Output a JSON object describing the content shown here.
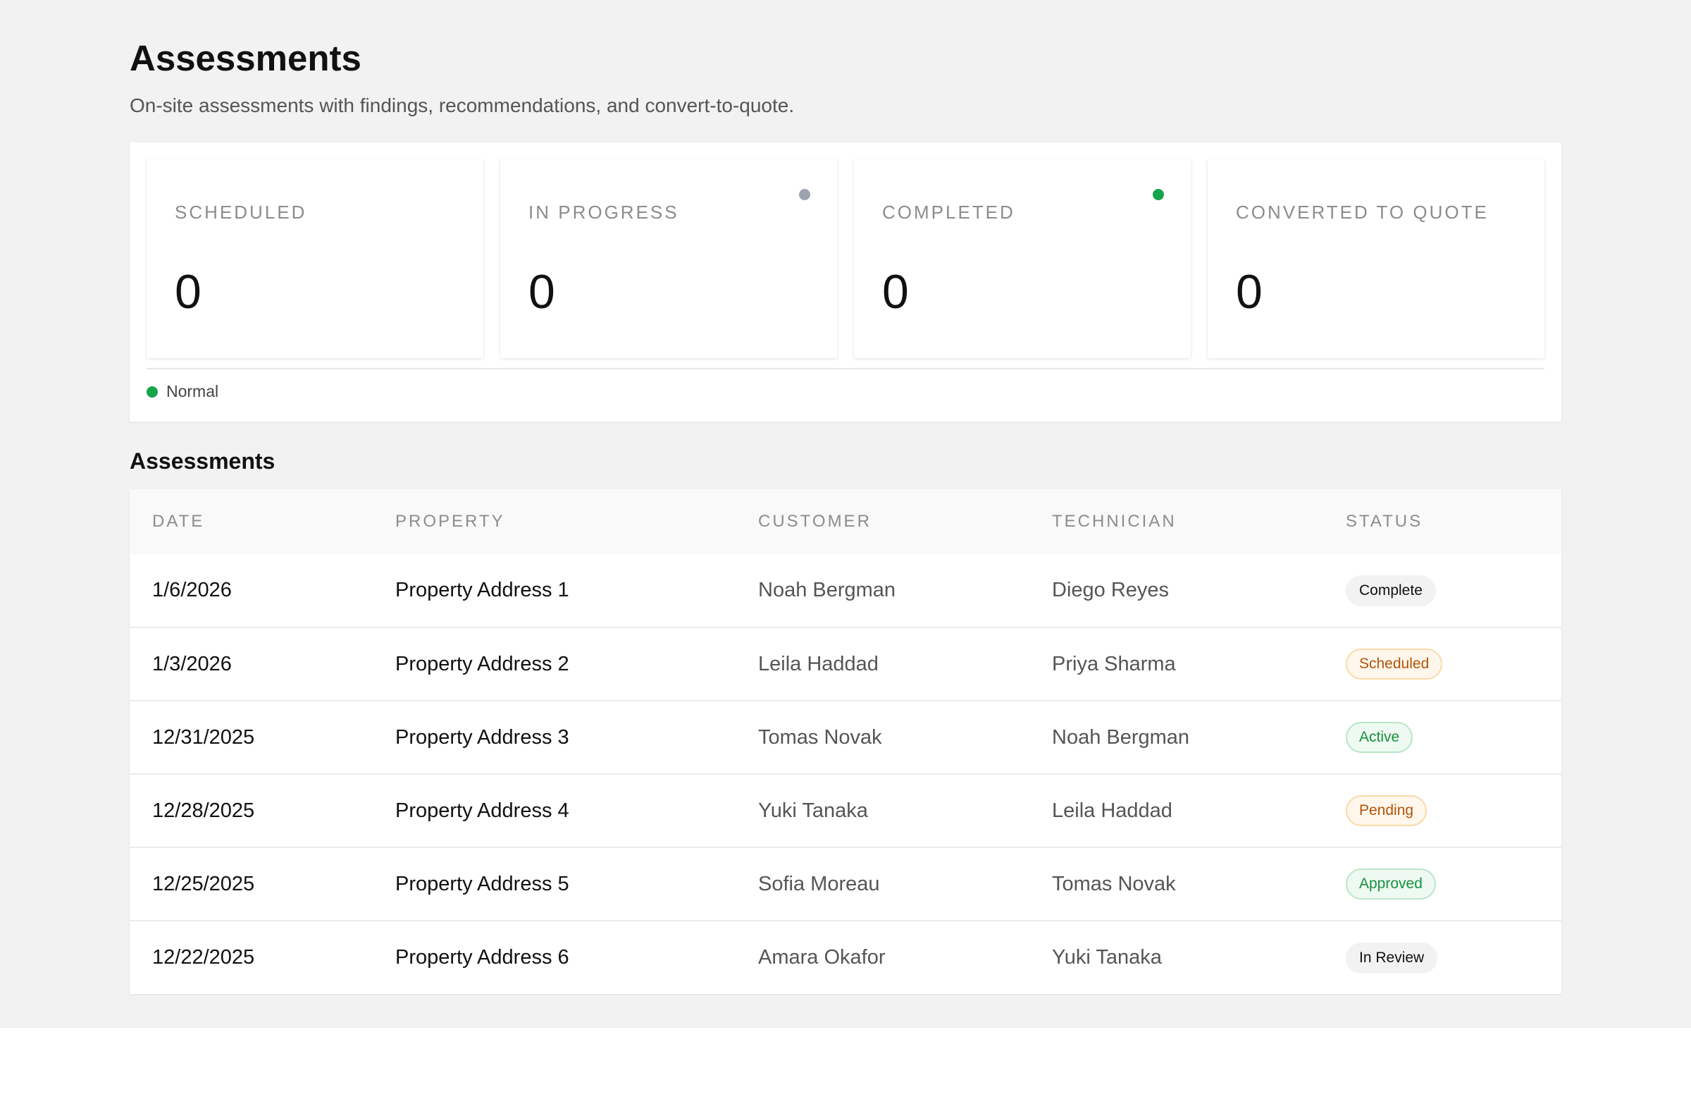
{
  "header": {
    "title": "Assessments",
    "subtitle": "On-site assessments with findings, recommendations, and convert-to-quote."
  },
  "kpis": [
    {
      "label": "SCHEDULED",
      "value": "0",
      "dot_color": null
    },
    {
      "label": "IN PROGRESS",
      "value": "0",
      "dot_color": "#9ca3af"
    },
    {
      "label": "COMPLETED",
      "value": "0",
      "dot_color": "#16a34a"
    },
    {
      "label": "CONVERTED TO QUOTE",
      "value": "0",
      "dot_color": null
    }
  ],
  "legend": {
    "label": "Normal",
    "color": "#16a34a"
  },
  "table": {
    "section_title": "Assessments",
    "columns": [
      "DATE",
      "PROPERTY",
      "CUSTOMER",
      "TECHNICIAN",
      "STATUS"
    ],
    "rows": [
      {
        "date": "1/6/2026",
        "property": "Property Address 1",
        "customer": "Noah Bergman",
        "technician": "Diego Reyes",
        "status": "Complete",
        "status_tone": "neutral"
      },
      {
        "date": "1/3/2026",
        "property": "Property Address 2",
        "customer": "Leila Haddad",
        "technician": "Priya Sharma",
        "status": "Scheduled",
        "status_tone": "warning"
      },
      {
        "date": "12/31/2025",
        "property": "Property Address 3",
        "customer": "Tomas Novak",
        "technician": "Noah Bergman",
        "status": "Active",
        "status_tone": "success"
      },
      {
        "date": "12/28/2025",
        "property": "Property Address 4",
        "customer": "Yuki Tanaka",
        "technician": "Leila Haddad",
        "status": "Pending",
        "status_tone": "warning"
      },
      {
        "date": "12/25/2025",
        "property": "Property Address 5",
        "customer": "Sofia Moreau",
        "technician": "Tomas Novak",
        "status": "Approved",
        "status_tone": "success"
      },
      {
        "date": "12/22/2025",
        "property": "Property Address 6",
        "customer": "Amara Okafor",
        "technician": "Yuki Tanaka",
        "status": "In Review",
        "status_tone": "neutral"
      }
    ]
  },
  "colors": {
    "page_background": "#f2f2f2",
    "status_success": "#15913d",
    "status_warning": "#b45309",
    "muted_label": "#8c8c8c"
  }
}
